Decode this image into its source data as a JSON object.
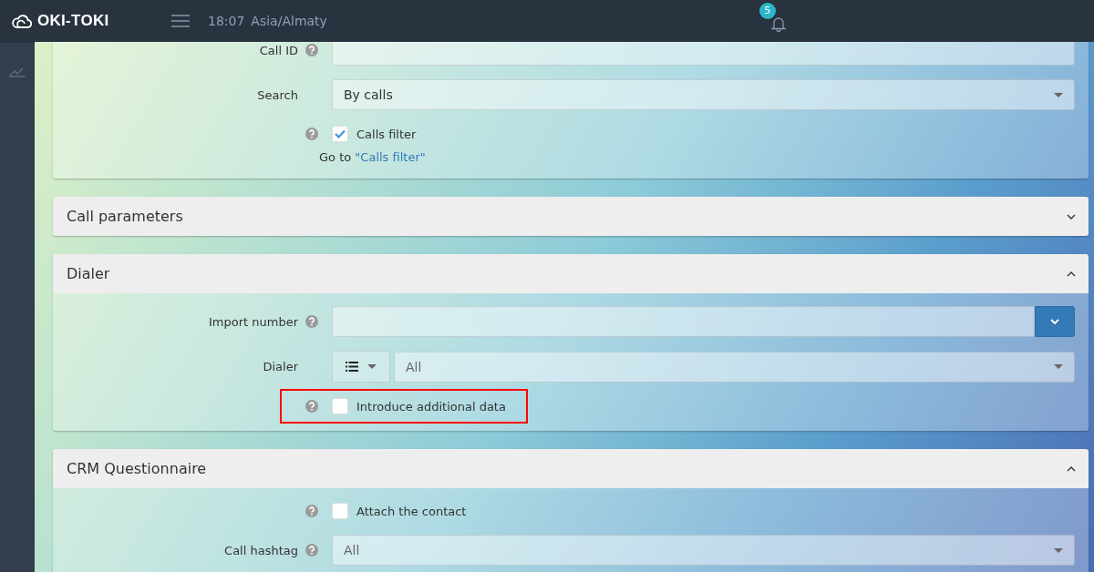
{
  "header": {
    "logo": "OKI-TOKI",
    "time": "18:07",
    "timezone": "Asia/Almaty",
    "notifications": "5"
  },
  "panels": [
    {
      "expanded": true,
      "rows": [
        {
          "kind": "input",
          "label": "Call ID",
          "help": true
        },
        {
          "kind": "select",
          "label": "Search",
          "value": "By calls",
          "help": false
        },
        {
          "kind": "checkbox",
          "label": "Calls filter",
          "checked": true,
          "help": true,
          "highlighted": false
        },
        {
          "kind": "link",
          "prefix": "Go to",
          "link": "\"Calls filter\""
        }
      ]
    },
    {
      "title": "Call parameters",
      "expanded": false
    },
    {
      "title": "Dialer",
      "expanded": true,
      "rows": [
        {
          "kind": "input_dropdown",
          "label": "Import number",
          "help": true
        },
        {
          "kind": "dialer",
          "label": "Dialer",
          "placeholder": "All",
          "help": false
        },
        {
          "kind": "checkbox",
          "label": "Introduce additional data",
          "checked": false,
          "help": true,
          "highlighted": true
        }
      ]
    },
    {
      "title": "CRM Questionnaire",
      "expanded": true,
      "rows": [
        {
          "kind": "checkbox",
          "label": "Attach the contact",
          "checked": false,
          "help": true,
          "highlighted": false
        },
        {
          "kind": "select",
          "label": "Call hashtag",
          "placeholder": "All",
          "help": true
        }
      ]
    }
  ]
}
